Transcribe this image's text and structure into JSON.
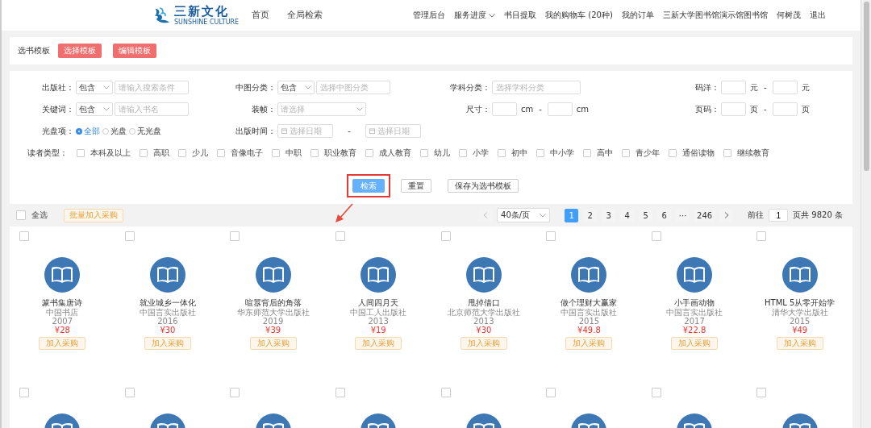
{
  "header": {
    "logo_text": "三新文化",
    "logo_sub": "SUNSHINE CULTURE",
    "main_nav": [
      {
        "label": "首页"
      },
      {
        "label": "全局检索"
      }
    ],
    "user_nav": [
      {
        "label": "管理后台",
        "dropdown": false
      },
      {
        "label": "服务进度",
        "dropdown": true
      },
      {
        "label": "书目提取",
        "dropdown": false
      },
      {
        "label": "我的购物车 (20种)",
        "dropdown": false
      },
      {
        "label": "我的订单",
        "dropdown": false
      },
      {
        "label": "三新大学图书馆演示馆图书馆",
        "dropdown": false
      },
      {
        "label": "何树茂",
        "dropdown": false
      },
      {
        "label": "退出",
        "dropdown": false
      }
    ]
  },
  "template_bar": {
    "label": "选书模板",
    "buttons": [
      "选择模板",
      "编辑模板"
    ]
  },
  "filters": [
    [
      {
        "kind": "select-input",
        "label": "出版社：",
        "select": "包含",
        "placeholder": "请输入搜索条件"
      },
      {
        "kind": "select-input",
        "label": "中图分类：",
        "select": "包含",
        "placeholder": "选择中图分类"
      },
      {
        "kind": "input",
        "label": "学科分类：",
        "placeholder": "选择学科分类"
      },
      {
        "kind": "range",
        "label": "码洋：",
        "units": [
          "元",
          "元"
        ],
        "separator": "-"
      }
    ],
    [
      {
        "kind": "select-input",
        "label": "关键词：",
        "select": "包含",
        "placeholder": "请输入书名"
      },
      {
        "kind": "dropdown",
        "label": "装帧：",
        "placeholder": "请选择"
      },
      {
        "kind": "range",
        "label": "尺寸：",
        "units": [
          "cm",
          "cm"
        ],
        "separator": "-"
      },
      {
        "kind": "range",
        "label": "页码：",
        "units": [
          "页",
          "页"
        ],
        "separator": "-"
      }
    ],
    [
      {
        "kind": "radios",
        "label": "光盘项：",
        "options": [
          {
            "label": "全部",
            "selected": true
          },
          {
            "label": "光盘",
            "selected": false
          },
          {
            "label": "无光盘",
            "selected": false
          }
        ]
      },
      {
        "kind": "dates",
        "label": "出版时间：",
        "placeholders": [
          "选择日期",
          "选择日期"
        ],
        "separator": "-"
      }
    ]
  ],
  "reader_types": {
    "label": "读者类型：",
    "options": [
      {
        "label": "本科及以上",
        "checked": false
      },
      {
        "label": "高职",
        "checked": false
      },
      {
        "label": "少儿",
        "checked": false
      },
      {
        "label": "音像电子",
        "checked": false
      },
      {
        "label": "中职",
        "checked": false
      },
      {
        "label": "职业教育",
        "checked": false
      },
      {
        "label": "成人教育",
        "checked": false
      },
      {
        "label": "幼儿",
        "checked": false
      },
      {
        "label": "小学",
        "checked": false
      },
      {
        "label": "初中",
        "checked": false
      },
      {
        "label": "中小学",
        "checked": false
      },
      {
        "label": "高中",
        "checked": false
      },
      {
        "label": "青少年",
        "checked": false
      },
      {
        "label": "通俗读物",
        "checked": false
      },
      {
        "label": "继续教育",
        "checked": false
      }
    ]
  },
  "actions": [
    {
      "label": "检索",
      "kind": "primary"
    },
    {
      "label": "重置",
      "kind": "default"
    },
    {
      "label": "保存为选书模板",
      "kind": "default"
    }
  ],
  "primary_highlight_frame": true,
  "arrow_annotation": true,
  "toolbar": {
    "select_all": {
      "label": "全选",
      "checked": false
    },
    "batch_button": "批量加入采购"
  },
  "pagination": {
    "page_size": "40条/页",
    "pages": [
      {
        "label": "1",
        "selected": true
      },
      {
        "label": "2",
        "selected": false
      },
      {
        "label": "3",
        "selected": false
      },
      {
        "label": "4",
        "selected": false
      },
      {
        "label": "5",
        "selected": false
      },
      {
        "label": "6",
        "selected": false
      },
      {
        "label": "···",
        "selected": false
      },
      {
        "label": "246",
        "selected": false
      }
    ],
    "goto_label": "前往",
    "goto_value": "1",
    "total": "页共 9820 条"
  },
  "books": [
    {
      "checked": false,
      "title": "篆书集唐诗",
      "publisher": "中国书店",
      "year": "2007",
      "price": "¥28",
      "button": "加入采购"
    },
    {
      "checked": false,
      "title": "就业城乡一体化",
      "publisher": "中国言实出版社",
      "year": "2016",
      "price": "¥30",
      "button": "加入采购"
    },
    {
      "checked": false,
      "title": "喧嚣背后的角落",
      "publisher": "华东师范大学出版社",
      "year": "2019",
      "price": "¥39",
      "button": "加入采购"
    },
    {
      "checked": false,
      "title": "人间四月天",
      "publisher": "中国工人出版社",
      "year": "2013",
      "price": "¥19",
      "button": "加入采购"
    },
    {
      "checked": false,
      "title": "甩掉借口",
      "publisher": "北京师范大学出版社",
      "year": "2013",
      "price": "¥30",
      "button": "加入采购"
    },
    {
      "checked": false,
      "title": "做个理财大赢家",
      "publisher": "中国言实出版社",
      "year": "2015",
      "price": "¥49.8",
      "button": "加入采购"
    },
    {
      "checked": false,
      "title": "小手画动物",
      "publisher": "中国言实出版社",
      "year": "2017",
      "price": "¥22.8",
      "button": "加入采购"
    },
    {
      "checked": false,
      "title": "HTML 5从零开始学",
      "publisher": "清华大学出版社",
      "year": "2015",
      "price": "¥49",
      "button": "加入采购"
    },
    {
      "checked": false
    },
    {
      "checked": false
    },
    {
      "checked": false
    },
    {
      "checked": false
    },
    {
      "checked": false
    },
    {
      "checked": false
    },
    {
      "checked": false
    },
    {
      "checked": false
    }
  ]
}
